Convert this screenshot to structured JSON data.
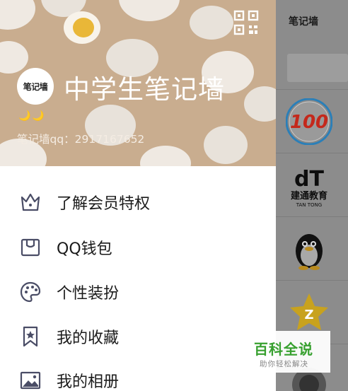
{
  "drawer": {
    "avatar_text": "笔记墙",
    "nickname": "中学生笔记墙",
    "status_emoji": "🌙🌙",
    "account_text": "笔记墙qq：2917167652",
    "menu": [
      {
        "label": "了解会员特权",
        "icon": "crown-icon"
      },
      {
        "label": "QQ钱包",
        "icon": "wallet-icon"
      },
      {
        "label": "个性装扮",
        "icon": "palette-icon"
      },
      {
        "label": "我的收藏",
        "icon": "bookmark-star-icon"
      },
      {
        "label": "我的相册",
        "icon": "photo-album-icon"
      }
    ]
  },
  "background_app": {
    "title": "笔记墙",
    "items": [
      "作业帮100分",
      "dT 建通教育",
      "企鹅",
      "QQ空间"
    ]
  },
  "watermark": {
    "main": "百科全说",
    "sub": "助你轻松解决"
  },
  "colors": {
    "banner": "#c9ad8f",
    "overlay": "#8c8c8c",
    "watermark_green": "#37a02f"
  }
}
